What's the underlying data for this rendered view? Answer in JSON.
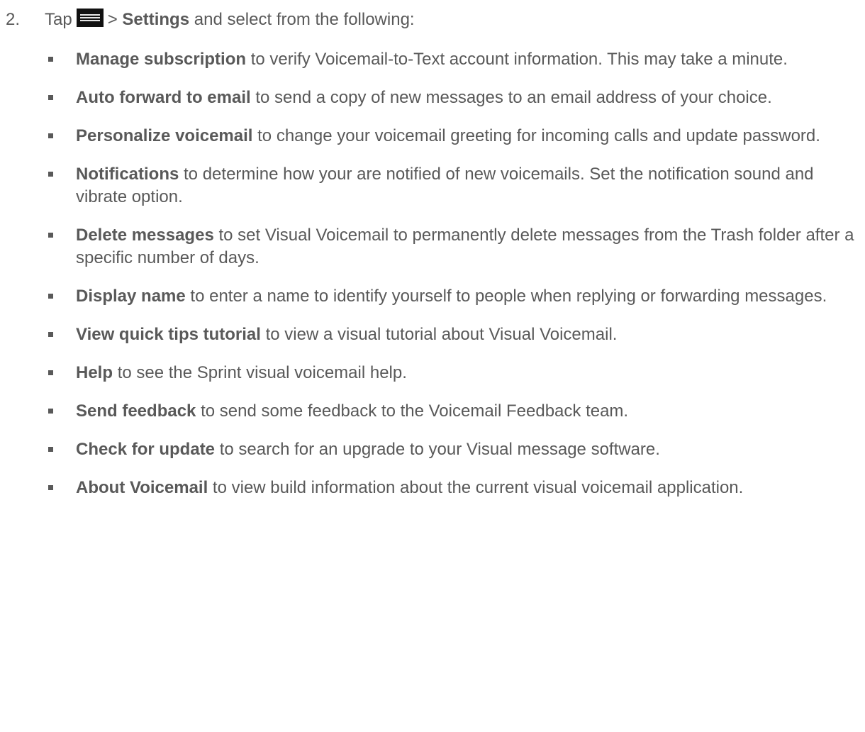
{
  "step": {
    "number": "2.",
    "text_before_icon": "Tap",
    "icon": "menu-icon",
    "text_after_icon": ">",
    "bold_term": "Settings",
    "text_after_bold": "and select from the following:"
  },
  "options": [
    {
      "term": "Manage subscription",
      "description": "to verify Voicemail-to-Text account information. This may take a minute."
    },
    {
      "term": "Auto forward to email",
      "description": "to send a copy of new messages to an email address of your choice."
    },
    {
      "term": "Personalize voicemail",
      "description": "to change your voicemail greeting for incoming calls and update password."
    },
    {
      "term": "Notifications",
      "description": "to determine how your are notified of new voicemails. Set the notification sound and vibrate option."
    },
    {
      "term": "Delete messages",
      "description": "to set Visual Voicemail to permanently delete messages from the Trash folder after a specific number of days."
    },
    {
      "term": "Display name",
      "description": "to enter a name to identify yourself to people when replying or forwarding messages."
    },
    {
      "term": "View quick tips tutorial",
      "description": "to view a visual tutorial about Visual Voicemail."
    },
    {
      "term": "Help",
      "description": "to see the Sprint visual voicemail help."
    },
    {
      "term": "Send feedback",
      "description": "to send some feedback to the Voicemail Feedback team."
    },
    {
      "term": "Check for update",
      "description": "to search for an upgrade to your Visual message software."
    },
    {
      "term": "About Voicemail",
      "description": "to view build information about the current visual voicemail application."
    }
  ]
}
